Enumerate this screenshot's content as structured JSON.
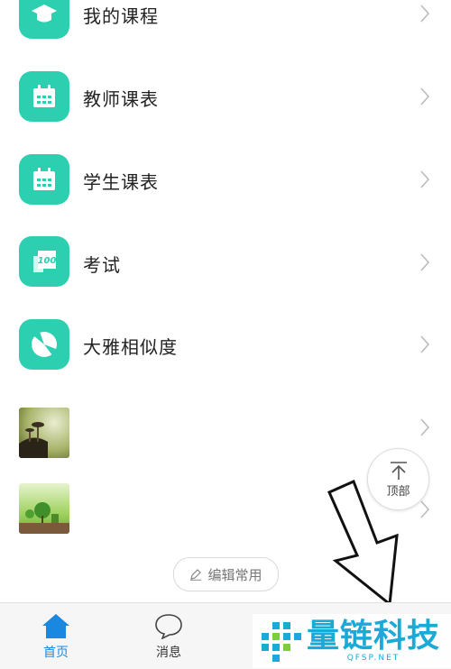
{
  "menu": [
    {
      "label": "我的课程",
      "icon": "graduation-cap-icon"
    },
    {
      "label": "教师课表",
      "icon": "calendar-icon"
    },
    {
      "label": "学生课表",
      "icon": "calendar-icon"
    },
    {
      "label": "考试",
      "icon": "score-100-icon"
    },
    {
      "label": "大雅相似度",
      "icon": "pie-slice-icon"
    }
  ],
  "extra_items": [
    {
      "thumbnail": "mushroom-photo"
    },
    {
      "thumbnail": "tree-landscape-photo"
    }
  ],
  "edit_button": {
    "label": "编辑常用",
    "icon": "pencil-icon"
  },
  "back_to_top": {
    "label": "顶部",
    "icon": "arrow-up-to-top-icon"
  },
  "tabbar": {
    "items": [
      {
        "label": "首页",
        "icon": "home-icon",
        "active": true
      },
      {
        "label": "消息",
        "icon": "chat-bubble-icon",
        "active": false
      }
    ]
  },
  "watermark": {
    "title": "量链科技",
    "subtitle": "QFSP.NET"
  },
  "colors": {
    "accent": "#2ccfb0",
    "tab_active": "#1a88e0",
    "watermark": "#1aaad8"
  }
}
